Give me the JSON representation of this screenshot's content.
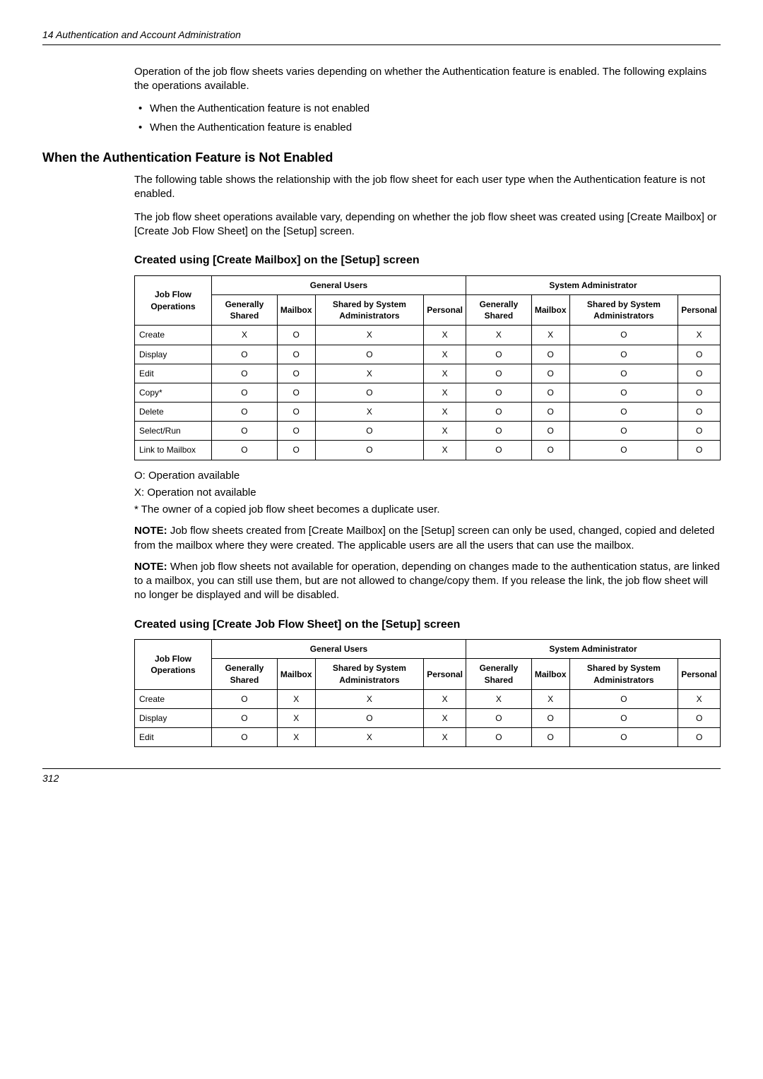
{
  "header": "14  Authentication and Account Administration",
  "intro": "Operation of the job flow sheets varies depending on whether the Authentication feature is enabled. The following explains the operations available.",
  "bullets": [
    "When the Authentication feature is not enabled",
    "When the Authentication feature is enabled"
  ],
  "section_title": "When the Authentication Feature is Not Enabled",
  "para1": "The following table shows the relationship with the job flow sheet for each user type when the Authentication feature is not enabled.",
  "para2": "The job flow sheet operations available vary, depending on whether the job flow sheet was created using [Create Mailbox] or [Create Job Flow Sheet] on the [Setup] screen.",
  "table1_title": "Created using [Create Mailbox] on the [Setup] screen",
  "col_group1": "General Users",
  "col_group2": "System Administrator",
  "col_rowhead": "Job Flow Operations",
  "col_gs": "Generally Shared",
  "col_mb": "Mailbox",
  "col_sa": "Shared by System Adminis­trators",
  "col_pe": "Personal",
  "table1_rows": [
    {
      "op": "Create",
      "v": [
        "X",
        "O",
        "X",
        "X",
        "X",
        "X",
        "O",
        "X"
      ]
    },
    {
      "op": "Display",
      "v": [
        "O",
        "O",
        "O",
        "X",
        "O",
        "O",
        "O",
        "O"
      ]
    },
    {
      "op": "Edit",
      "v": [
        "O",
        "O",
        "X",
        "X",
        "O",
        "O",
        "O",
        "O"
      ]
    },
    {
      "op": "Copy*",
      "v": [
        "O",
        "O",
        "O",
        "X",
        "O",
        "O",
        "O",
        "O"
      ]
    },
    {
      "op": "Delete",
      "v": [
        "O",
        "O",
        "X",
        "X",
        "O",
        "O",
        "O",
        "O"
      ]
    },
    {
      "op": "Select/Run",
      "v": [
        "O",
        "O",
        "O",
        "X",
        "O",
        "O",
        "O",
        "O"
      ]
    },
    {
      "op": "Link to Mailbox",
      "v": [
        "O",
        "O",
        "O",
        "X",
        "O",
        "O",
        "O",
        "O"
      ]
    }
  ],
  "legend_o": "O: Operation available",
  "legend_x": "X: Operation not available",
  "legend_star": "*  The owner of a copied job flow sheet becomes a duplicate user.",
  "note1_label": "NOTE:",
  "note1": "Job flow sheets created from [Create Mailbox] on the [Setup] screen can only be used, changed, copied and deleted from the mailbox where they were created. The applicable users are all the users that can use the mailbox.",
  "note2": "When job flow sheets not available for operation, depending on changes made to the authentication status, are linked to a mailbox, you can still use them, but are not allowed to change/copy them. If you release the link, the job flow sheet will no longer be displayed and will be disabled.",
  "table2_title": "Created using [Create Job Flow Sheet] on the [Setup] screen",
  "table2_rows": [
    {
      "op": "Create",
      "v": [
        "O",
        "X",
        "X",
        "X",
        "X",
        "X",
        "O",
        "X"
      ]
    },
    {
      "op": "Display",
      "v": [
        "O",
        "X",
        "O",
        "X",
        "O",
        "O",
        "O",
        "O"
      ]
    },
    {
      "op": "Edit",
      "v": [
        "O",
        "X",
        "X",
        "X",
        "O",
        "O",
        "O",
        "O"
      ]
    }
  ],
  "page_number": "312"
}
